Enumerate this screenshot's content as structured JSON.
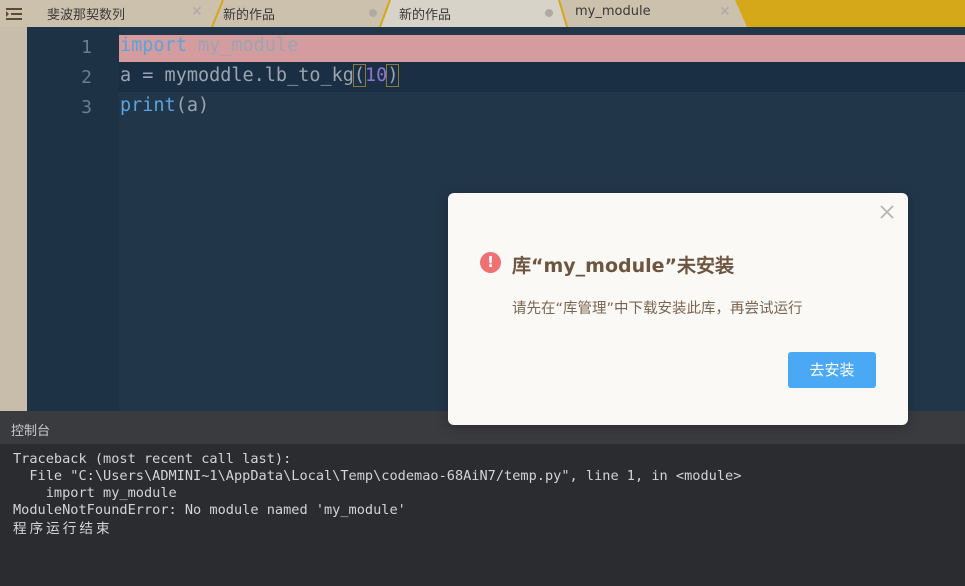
{
  "tabs": [
    {
      "label": "斐波那契数列",
      "state": "close"
    },
    {
      "label": "新的作品",
      "state": "modified"
    },
    {
      "label": "新的作品",
      "state": "modified"
    },
    {
      "label": "my_module",
      "state": "close"
    }
  ],
  "editor": {
    "line_numbers": [
      "1",
      "2",
      "3"
    ],
    "lines": [
      {
        "kw": "import",
        "rest": " my_module"
      },
      {
        "a": "a = mymoddle.lb_to_kg",
        "lp": "(",
        "num": "10",
        "rp": ")"
      },
      {
        "kw": "print",
        "rest": "(a)"
      }
    ]
  },
  "console": {
    "title": "控制台",
    "lines": [
      "Traceback (most recent call last):",
      "  File \"C:\\Users\\ADMINI~1\\AppData\\Local\\Temp\\codemao-68AiN7/temp.py\", line 1, in <module>",
      "    import my_module",
      "ModuleNotFoundError: No module named 'my_module'",
      "程序运行结束"
    ]
  },
  "modal": {
    "icon": "!",
    "title": "库“my_module”未安装",
    "message": "请先在“库管理”中下载安装此库，再尝试运行",
    "button": "去安装"
  },
  "colors": {
    "accent": "#d4a818",
    "error_line": "#d49c9f",
    "button": "#4ba8f5",
    "error_icon": "#f07173"
  }
}
